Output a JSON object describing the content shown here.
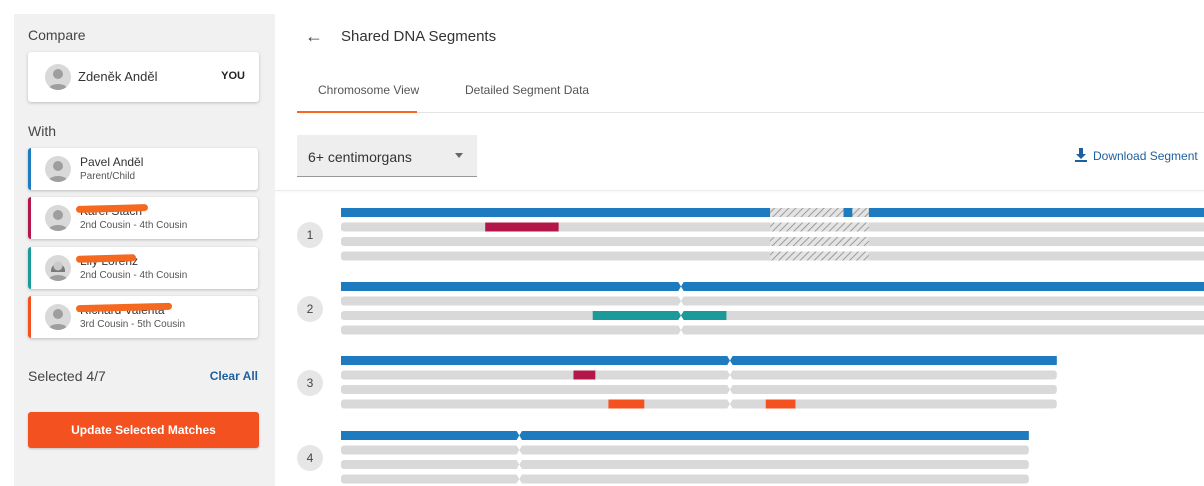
{
  "sidebar": {
    "compare_label": "Compare",
    "you": {
      "name": "Zdeněk Anděl",
      "badge": "YOU"
    },
    "with_label": "With",
    "matches": [
      {
        "name": "Pavel Anděl",
        "relationship": "Parent/Child",
        "color": "#1f7bbf",
        "redacted": false,
        "gender": "male"
      },
      {
        "name": "Karel Stach",
        "relationship": "2nd Cousin - 4th Cousin",
        "color": "#b3174a",
        "redacted": true,
        "gender": "male"
      },
      {
        "name": "Lily Lorenz",
        "relationship": "2nd Cousin - 4th Cousin",
        "color": "#1a9a9a",
        "redacted": true,
        "gender": "female"
      },
      {
        "name": "Richard Valenta",
        "relationship": "3rd Cousin - 5th Cousin",
        "color": "#f3511f",
        "redacted": true,
        "gender": "male"
      }
    ],
    "selected": "Selected 4/7",
    "clear_all": "Clear All",
    "update_button": "Update Selected Matches"
  },
  "header": {
    "back_icon": "arrow-left-icon",
    "title": "Shared DNA Segments"
  },
  "tabs": [
    {
      "label": "Chromosome View",
      "active": true
    },
    {
      "label": "Detailed Segment Data",
      "active": false
    }
  ],
  "filter": {
    "value": "6+ centimorgans",
    "icon": "caret-down-icon"
  },
  "download": {
    "label": "Download Segment",
    "icon": "download-icon"
  },
  "colors": {
    "you": "#1f7bbf",
    "track": "#d9d9d9",
    "match_2": "#b3174a",
    "match_3": "#1a9a9a",
    "match_4": "#f3511f"
  },
  "chromosomes": [
    {
      "number": "1",
      "centromere": 0.491,
      "length": 1.0,
      "hatch": [
        0.491,
        0.604
      ],
      "segments": [
        {
          "track": 0,
          "start": 0.0,
          "end": 0.491,
          "color": "#1f7bbf"
        },
        {
          "track": 0,
          "start": 0.575,
          "end": 0.585,
          "color": "#1f7bbf"
        },
        {
          "track": 0,
          "start": 0.594,
          "end": 1.0,
          "color": "#1f7bbf"
        },
        {
          "track": 1,
          "start": 0.165,
          "end": 0.249,
          "color": "#b3174a"
        }
      ]
    },
    {
      "number": "2",
      "centromere": 0.389,
      "length": 1.0,
      "segments": [
        {
          "track": 0,
          "start": 0.0,
          "end": 1.0,
          "color": "#1f7bbf"
        },
        {
          "track": 2,
          "start": 0.288,
          "end": 0.441,
          "color": "#1a9a9a"
        }
      ]
    },
    {
      "number": "3",
      "centromere": 0.445,
      "length": 0.819,
      "segments": [
        {
          "track": 0,
          "start": 0.0,
          "end": 0.819,
          "color": "#1f7bbf"
        },
        {
          "track": 1,
          "start": 0.266,
          "end": 0.291,
          "color": "#b3174a"
        },
        {
          "track": 3,
          "start": 0.306,
          "end": 0.347,
          "color": "#f3511f"
        },
        {
          "track": 3,
          "start": 0.486,
          "end": 0.52,
          "color": "#f3511f"
        }
      ]
    },
    {
      "number": "4",
      "centromere": 0.204,
      "length": 0.787,
      "segments": [
        {
          "track": 0,
          "start": 0.0,
          "end": 0.787,
          "color": "#1f7bbf"
        }
      ]
    }
  ]
}
